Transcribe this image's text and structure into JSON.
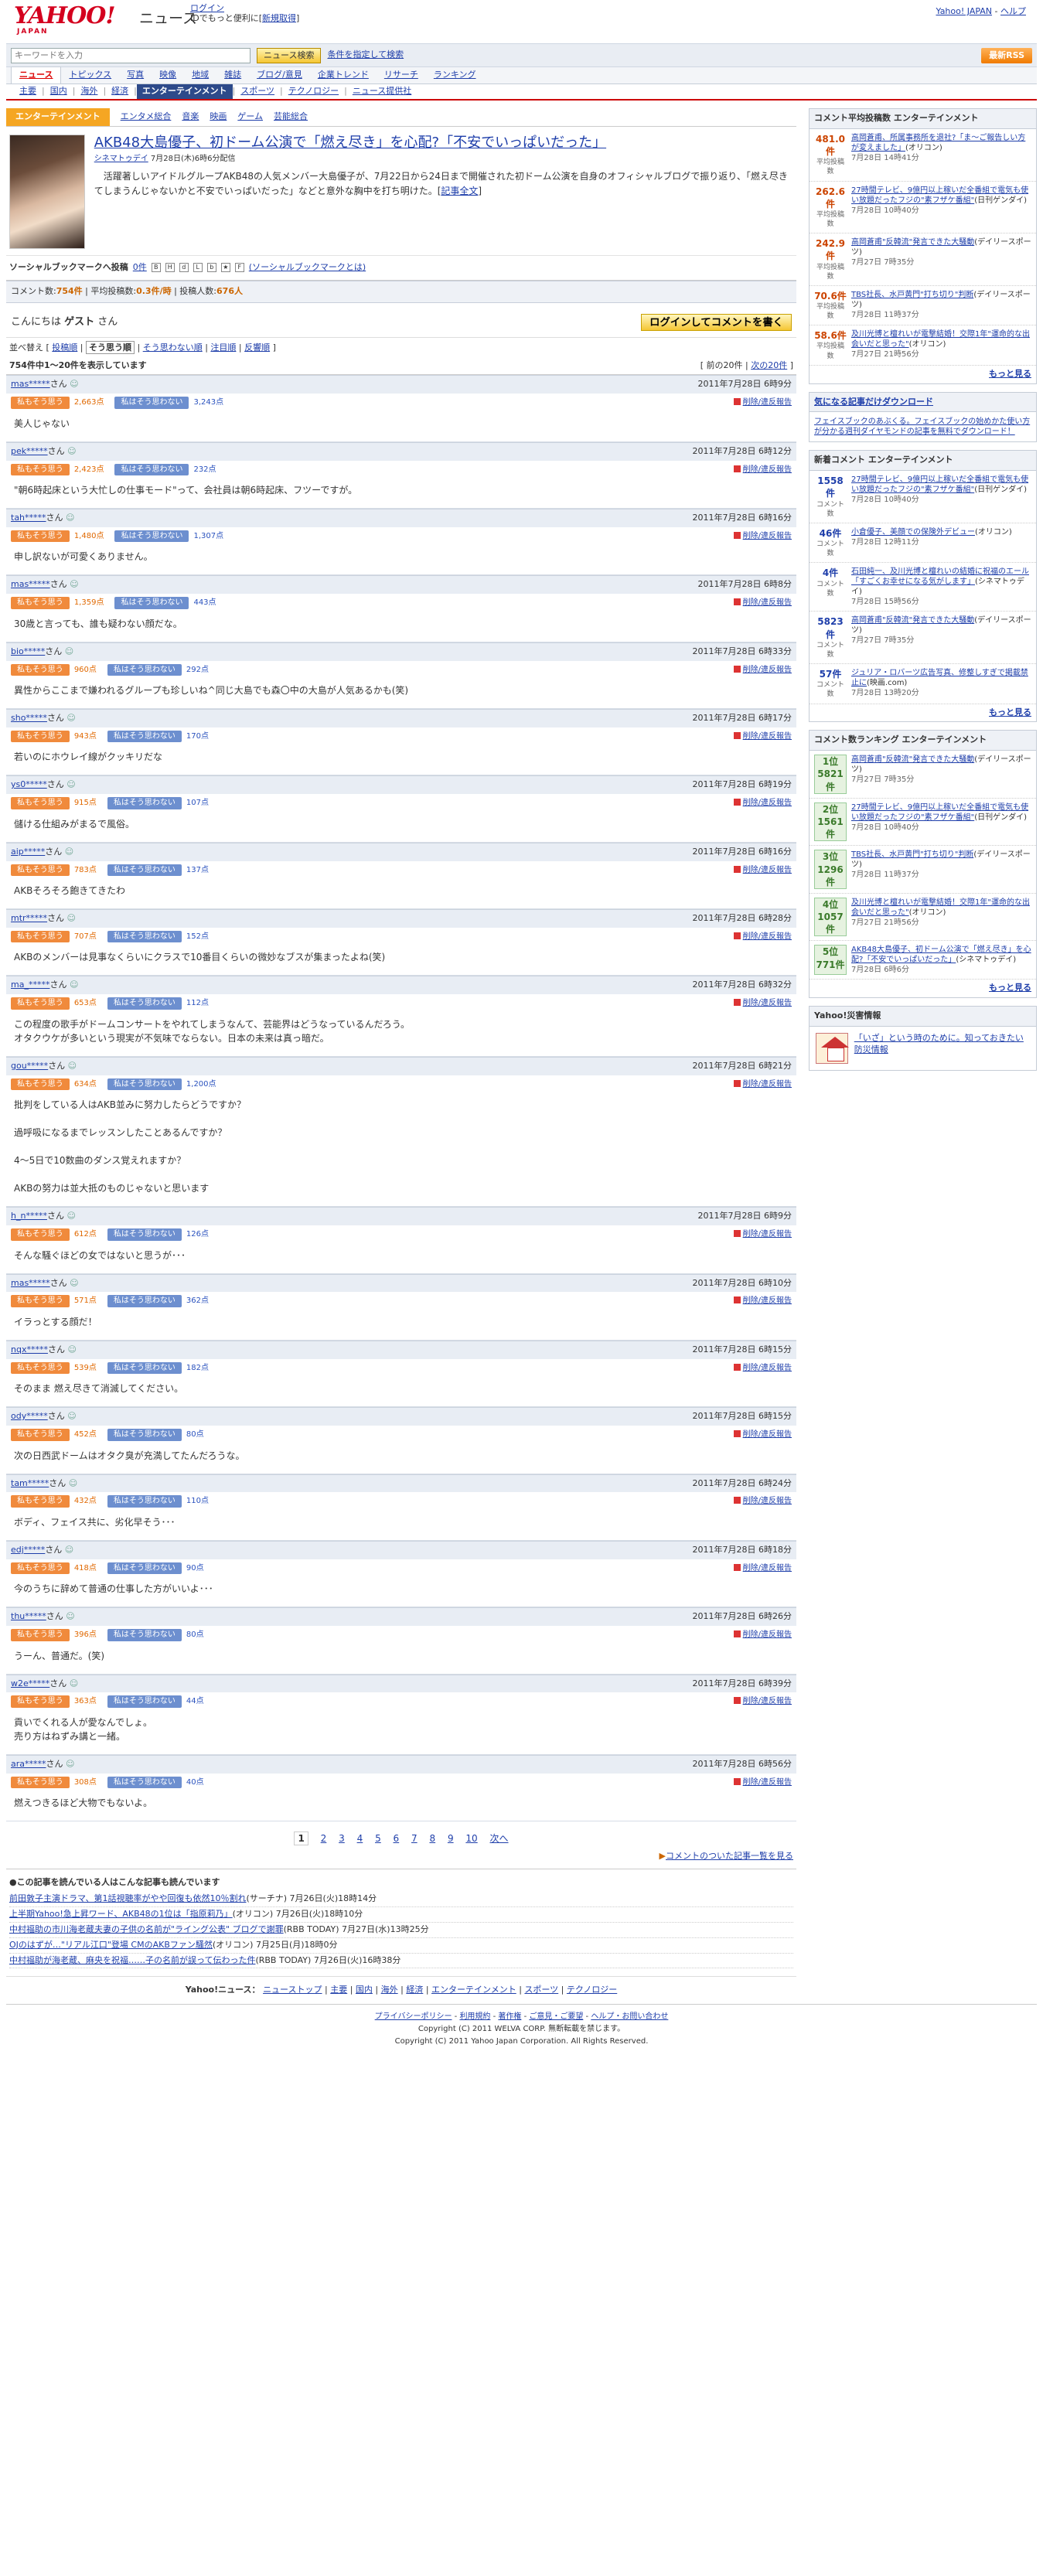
{
  "header": {
    "logo_text": "YAHOO!",
    "logo_sub": "JAPAN",
    "site_name": "ニュース",
    "login_link": "ログイン",
    "login_note": "IDでもっと便利に[",
    "signup_link": "新規取得",
    "signup_end": "]",
    "top_right_1": "Yahoo! JAPAN",
    "top_right_sep": " - ",
    "top_right_2": "ヘルプ"
  },
  "search": {
    "placeholder": "キーワードを入力",
    "button": "ニュース検索",
    "advanced": "条件を指定して検索",
    "rss": "最新RSS"
  },
  "nav1": [
    "ニュース",
    "トピックス",
    "写真",
    "映像",
    "地域",
    "雑誌",
    "ブログ/意見",
    "企業トレンド",
    "リサーチ",
    "ランキング"
  ],
  "nav2": [
    "主要",
    "国内",
    "海外",
    "経済",
    "エンターテインメント",
    "スポーツ",
    "テクノロジー",
    "ニュース提供社"
  ],
  "category": {
    "current": "エンターテインメント",
    "links": [
      "エンタメ総合",
      "音楽",
      "映画",
      "ゲーム",
      "芸能総合"
    ]
  },
  "article": {
    "title": "AKB48大島優子、初ドーム公演で「燃え尽き」を心配?「不安でいっぱいだった」",
    "source": "シネマトゥデイ",
    "date": " 7月28日(木)6時6分配信",
    "body": "　活躍著しいアイドルグループAKB48の人気メンバー大島優子が、7月22日から24日まで開催された初ドーム公演を自身のオフィシャルブログで振り返り、「燃え尽きてしまうんじゃないかと不安でいっぱいだった」などと意外な胸中を打ち明けた。[",
    "more": "記事全文",
    "more_end": "]"
  },
  "social": {
    "label": "ソーシャルブックマークへ投稿",
    "count": "0件",
    "note": "(ソーシャルブックマークとは)"
  },
  "stats": {
    "label1": "コメント数:",
    "count": "754件",
    "label2": " | 平均投稿数:",
    "avg": "0.3件/時",
    "label3": " | 投稿人数:",
    "users": "676人"
  },
  "hello": {
    "prefix": "こんにちは ",
    "name": "ゲスト",
    "suffix": " さん",
    "login_btn": "ログインしてコメントを書く"
  },
  "sort": {
    "label": "並べ替え [",
    "items": [
      "投稿順",
      "そう思う順",
      "そう思わない順",
      "注目順",
      "反響順"
    ],
    "end": "]"
  },
  "count": {
    "text": "754件中1～20件を表示しています",
    "prev": "[ 前の20件 | ",
    "next": "次の20件",
    "next_end": " ]"
  },
  "vote": {
    "agree": "私もそう思う",
    "disagree": "私はそう思わない",
    "report": "削除/違反報告",
    "suffix": "さん"
  },
  "comments": [
    {
      "user": "mas*****",
      "time": "2011年7月28日 6時9分",
      "agree": "2,663点",
      "disagree": "3,243点",
      "text": "美人じゃない"
    },
    {
      "user": "pek*****",
      "time": "2011年7月28日 6時12分",
      "agree": "2,423点",
      "disagree": "232点",
      "text": "\"朝6時起床という大忙しの仕事モード\"って、会社員は朝6時起床、フツーですが。"
    },
    {
      "user": "tah*****",
      "time": "2011年7月28日 6時16分",
      "agree": "1,480点",
      "disagree": "1,307点",
      "text": "申し訳ないが可愛くありません。"
    },
    {
      "user": "mas*****",
      "time": "2011年7月28日 6時8分",
      "agree": "1,359点",
      "disagree": "443点",
      "text": "30歳と言っても、誰も疑わない顔だな。"
    },
    {
      "user": "bio*****",
      "time": "2011年7月28日 6時33分",
      "agree": "960点",
      "disagree": "292点",
      "text": "異性からここまで嫌われるグループも珍しいね^同じ大島でも森〇中の大島が人気あるかも(笑)"
    },
    {
      "user": "sho*****",
      "time": "2011年7月28日 6時17分",
      "agree": "943点",
      "disagree": "170点",
      "text": "若いのにホウレイ線がクッキリだな"
    },
    {
      "user": "ys0*****",
      "time": "2011年7月28日 6時19分",
      "agree": "915点",
      "disagree": "107点",
      "text": "儲ける仕組みがまるで風俗。"
    },
    {
      "user": "aip*****",
      "time": "2011年7月28日 6時16分",
      "agree": "783点",
      "disagree": "137点",
      "text": "AKBそろそろ飽きてきたわ"
    },
    {
      "user": "mtr*****",
      "time": "2011年7月28日 6時28分",
      "agree": "707点",
      "disagree": "152点",
      "text": "AKBのメンバーは見事なくらいにクラスで10番目くらいの微妙なブスが集まったよね(笑)"
    },
    {
      "user": "ma_*****",
      "time": "2011年7月28日 6時32分",
      "agree": "653点",
      "disagree": "112点",
      "text": "この程度の歌手がドームコンサートをやれてしまうなんて、芸能界はどうなっているんだろう。\nオタクウケが多いという現実が不気味でならない。日本の未来は真っ暗だ。"
    },
    {
      "user": "gou*****",
      "time": "2011年7月28日 6時21分",
      "agree": "634点",
      "disagree": "1,200点",
      "text": "批判をしている人はAKB並みに努力したらどうですか？\n\n過呼吸になるまでレッスンしたことあるんですか？\n\n4～5日で10数曲のダンス覚えれますか？\n\nAKBの努力は並大抵のものじゃないと思います"
    },
    {
      "user": "h_n*****",
      "time": "2011年7月28日 6時9分",
      "agree": "612点",
      "disagree": "126点",
      "text": "そんな騒ぐほどの女ではないと思うが･･･"
    },
    {
      "user": "mas*****",
      "time": "2011年7月28日 6時10分",
      "agree": "571点",
      "disagree": "362点",
      "text": "イラっとする顔だ！"
    },
    {
      "user": "nqx*****",
      "time": "2011年7月28日 6時15分",
      "agree": "539点",
      "disagree": "182点",
      "text": "そのまま 燃え尽きて消滅してください。"
    },
    {
      "user": "ody*****",
      "time": "2011年7月28日 6時15分",
      "agree": "452点",
      "disagree": "80点",
      "text": "次の日西武ドームはオタク臭が充満してたんだろうな。"
    },
    {
      "user": "tam*****",
      "time": "2011年7月28日 6時24分",
      "agree": "432点",
      "disagree": "110点",
      "text": "ボディ、フェイス共に、劣化早そう･･･"
    },
    {
      "user": "edj*****",
      "time": "2011年7月28日 6時18分",
      "agree": "418点",
      "disagree": "90点",
      "text": "今のうちに辞めて普通の仕事した方がいいよ･･･"
    },
    {
      "user": "thu*****",
      "time": "2011年7月28日 6時26分",
      "agree": "396点",
      "disagree": "80点",
      "text": "うーん、普通だ。(笑)"
    },
    {
      "user": "w2e*****",
      "time": "2011年7月28日 6時39分",
      "agree": "363点",
      "disagree": "44点",
      "text": "貢いでくれる人が愛なんでしょ。\n売り方はねずみ講と一緒。"
    },
    {
      "user": "ara*****",
      "time": "2011年7月28日 6時56分",
      "agree": "308点",
      "disagree": "40点",
      "text": "燃えつきるほど大物でもないよ。"
    }
  ],
  "pager": {
    "current": "1",
    "pages": [
      "2",
      "3",
      "4",
      "5",
      "6",
      "7",
      "8",
      "9",
      "10"
    ],
    "next": "次へ"
  },
  "more_list": "コメントのついた記事一覧を見る",
  "readers": {
    "title": "この記事を読んでいる人はこんな記事も読んでいます",
    "items": [
      {
        "title": "前田敦子主演ドラマ、第1話視聴率がやや回復も依然10％割れ",
        "src": "(サーチナ)",
        "date": " 7月26日(火)18時14分"
      },
      {
        "title": "上半期Yahoo!急上昇ワード、AKB48の1位は「指原莉乃」",
        "src": "(オリコン)",
        "date": " 7月26日(火)18時10分"
      },
      {
        "title": "中村福助の市川海老蔵夫妻の子供の名前が\"ライング公表\" ブログで謝罪",
        "src": "(RBB TODAY)",
        "date": " 7月27日(水)13時25分"
      },
      {
        "title": "OJのはずが…\"リアル江口\"登場 CMのAKBファン騒然",
        "src": "(オリコン)",
        "date": " 7月25日(月)18時0分"
      },
      {
        "title": "中村福助が海老蔵、麻央を祝福……子の名前が誤って伝わった件",
        "src": "(RBB TODAY)",
        "date": " 7月26日(火)16時38分"
      }
    ]
  },
  "footnav": {
    "label": "Yahoo!ニュース：",
    "items": [
      "ニューストップ",
      "主要",
      "国内",
      "海外",
      "経済",
      "エンターテインメント",
      "スポーツ",
      "テクノロジー"
    ]
  },
  "footer": {
    "links": [
      "プライバシーポリシー",
      "利用規約",
      "著作権",
      "ご意見・ご要望",
      "ヘルプ・お問い合わせ"
    ],
    "copy1": "Copyright (C) 2011 WELVA CORP. 無断転載を禁じます。",
    "copy2": "Copyright (C) 2011 Yahoo Japan Corporation. All Rights Reserved."
  },
  "side": {
    "avg_title": "コメント平均投稿数 エンターテインメント",
    "avg_unit": "平均投稿数",
    "avg": [
      {
        "n": "481.0件",
        "title": "高岡蒼甫、所属事務所を退社?「ま～ご報告しい方が変えました」",
        "src": "(オリコン)",
        "time": "7月28日 14時41分"
      },
      {
        "n": "262.6件",
        "title": "27時間テレビ、9億円以上稼いだ全番組で電気も使い放題だったフジの\"素フザケ番組\"",
        "src": "(日刊ゲンダイ)",
        "time": "7月28日 10時40分"
      },
      {
        "n": "242.9件",
        "title": "高岡蒼甫\"反韓流\"発言できた大騒動",
        "src": "(デイリースポーツ)",
        "time": "7月27日 7時35分"
      },
      {
        "n": "70.6件",
        "title": "TBS社長、水戸黄門\"打ち切り\"判断",
        "src": "(デイリースポーツ)",
        "time": "7月28日 11時37分"
      },
      {
        "n": "58.6件",
        "title": "及川光博と檀れいが電撃結婚！交際1年\"運命的な出会いだと思った\"",
        "src": "(オリコン)",
        "time": "7月27日 21時56分"
      }
    ],
    "more": "もっと見る",
    "app_title": "気になる記事だけダウンロード",
    "app_desc": "フェイスブックのあぶくる。フェイスブックの始めかた使い方が分かる週刊ダイヤモンドの記事を無料でダウンロード！",
    "new_title": "新着コメント エンターテインメント",
    "new_unit": "コメント数",
    "new": [
      {
        "n": "1558件",
        "title": "27時間テレビ、9億円以上稼いだ全番組で電気も使い放題だったフジの\"素フザケ番組\"",
        "src": "(日刊ゲンダイ)",
        "time": "7月28日 10時40分"
      },
      {
        "n": "46件",
        "title": "小倉優子、美顔での保険外デビュー",
        "src": "(オリコン)",
        "time": "7月28日 12時11分"
      },
      {
        "n": "4件",
        "title": "石田純一、及川光博と檀れいの結婚に祝福のエール「すごくお幸せになる気がします」",
        "src": "(シネマトゥデイ)",
        "time": "7月28日 15時56分"
      },
      {
        "n": "5823件",
        "title": "高岡蒼甫\"反韓流\"発言できた大騒動",
        "src": "(デイリースポーツ)",
        "time": "7月27日 7時35分"
      },
      {
        "n": "57件",
        "title": "ジュリア・ロバーツ広告写真、修整しすぎで掲載禁止に",
        "src": "(映画.com)",
        "time": "7月28日 13時20分"
      }
    ],
    "rank_title": "コメント数ランキング エンターテインメント",
    "rank": [
      {
        "pos": "1位",
        "n": "5821件",
        "title": "高岡蒼甫\"反韓流\"発言できた大騒動",
        "src": "(デイリースポーツ)",
        "time": "7月27日 7時35分"
      },
      {
        "pos": "2位",
        "n": "1561件",
        "title": "27時間テレビ、9億円以上稼いだ全番組で電気も使い放題だったフジの\"素フザケ番組\"",
        "src": "(日刊ゲンダイ)",
        "time": "7月28日 10時40分"
      },
      {
        "pos": "3位",
        "n": "1296件",
        "title": "TBS社長、水戸黄門\"打ち切り\"判断",
        "src": "(デイリースポーツ)",
        "time": "7月28日 11時37分"
      },
      {
        "pos": "4位",
        "n": "1057件",
        "title": "及川光博と檀れいが電撃結婚！交際1年\"運命的な出会いだと思った\"",
        "src": "(オリコン)",
        "time": "7月27日 21時56分"
      },
      {
        "pos": "5位",
        "n": "771件",
        "title": "AKB48大島優子、初ドーム公演で「燃え尽き」を心配?「不安でいっぱいだった」",
        "src": "(シネマトゥデイ)",
        "time": "7月28日 6時6分"
      }
    ],
    "disaster_title": "Yahoo!災害情報",
    "disaster_text": "「いざ」という時のために。知っておきたい防災情報"
  },
  "colors": {
    "accent": "#cc0000",
    "link": "#1e3eaa",
    "agree": "#f08a3c",
    "disagree": "#6d8fcf"
  }
}
